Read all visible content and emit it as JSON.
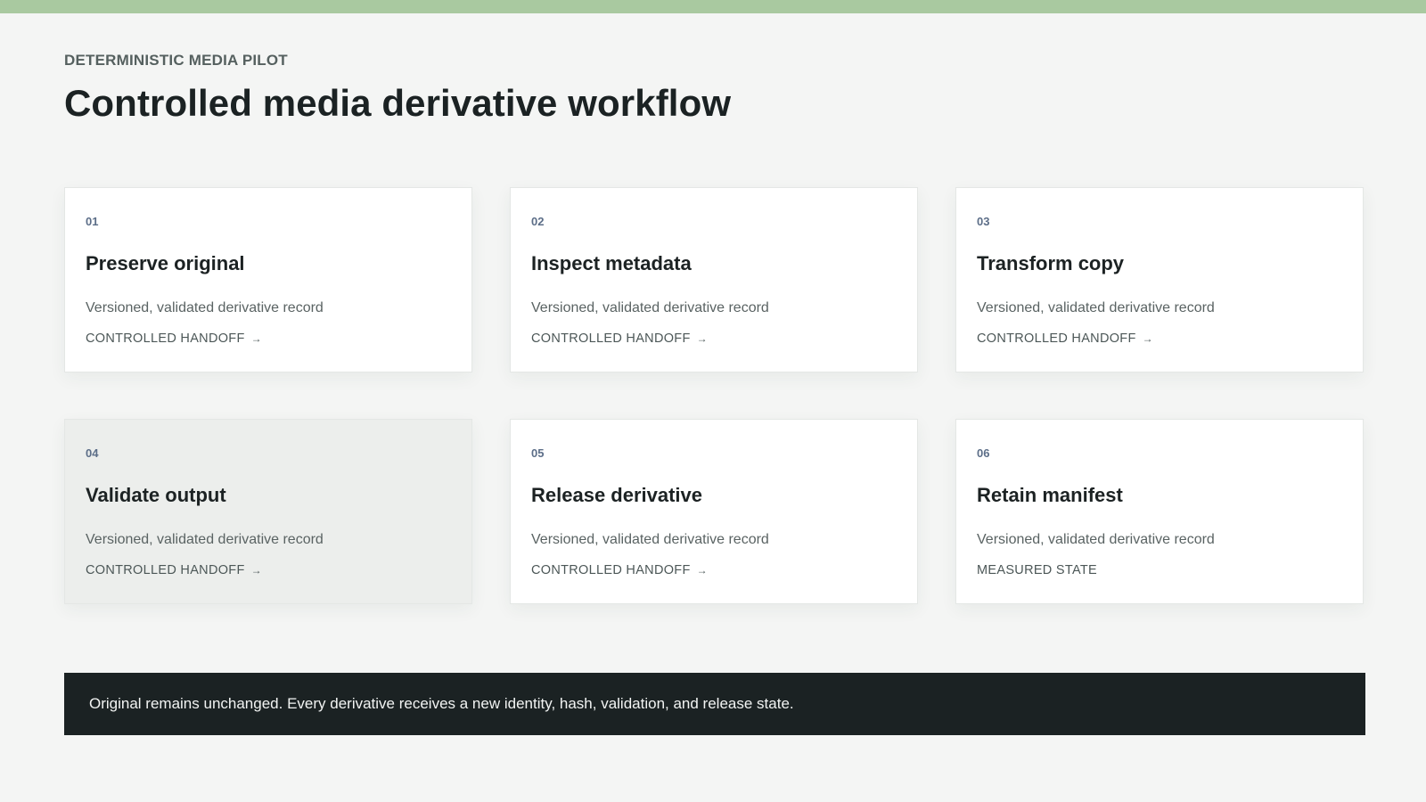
{
  "header": {
    "eyebrow": "DETERMINISTIC MEDIA PILOT",
    "title": "Controlled media derivative workflow"
  },
  "steps": [
    {
      "number": "01",
      "title": "Preserve original",
      "description": "Versioned, validated derivative record",
      "action": "CONTROLLED HANDOFF",
      "arrow": "→"
    },
    {
      "number": "02",
      "title": "Inspect metadata",
      "description": "Versioned, validated derivative record",
      "action": "CONTROLLED HANDOFF",
      "arrow": "→"
    },
    {
      "number": "03",
      "title": "Transform copy",
      "description": "Versioned, validated derivative record",
      "action": "CONTROLLED HANDOFF",
      "arrow": "→"
    },
    {
      "number": "04",
      "title": "Validate output",
      "description": "Versioned, validated derivative record",
      "action": "CONTROLLED HANDOFF",
      "arrow": "→"
    },
    {
      "number": "05",
      "title": "Release derivative",
      "description": "Versioned, validated derivative record",
      "action": "CONTROLLED HANDOFF",
      "arrow": "→"
    },
    {
      "number": "06",
      "title": "Retain manifest",
      "description": "Versioned, validated derivative record",
      "action": "MEASURED STATE"
    }
  ],
  "footer": {
    "note": "Original remains unchanged. Every derivative receives a new identity, hash, validation, and release state."
  },
  "colors": {
    "accent_bar": "#a9c9a0",
    "background": "#f4f5f4",
    "footer_bg": "#1b2223",
    "step_number": "#5c6e88"
  }
}
